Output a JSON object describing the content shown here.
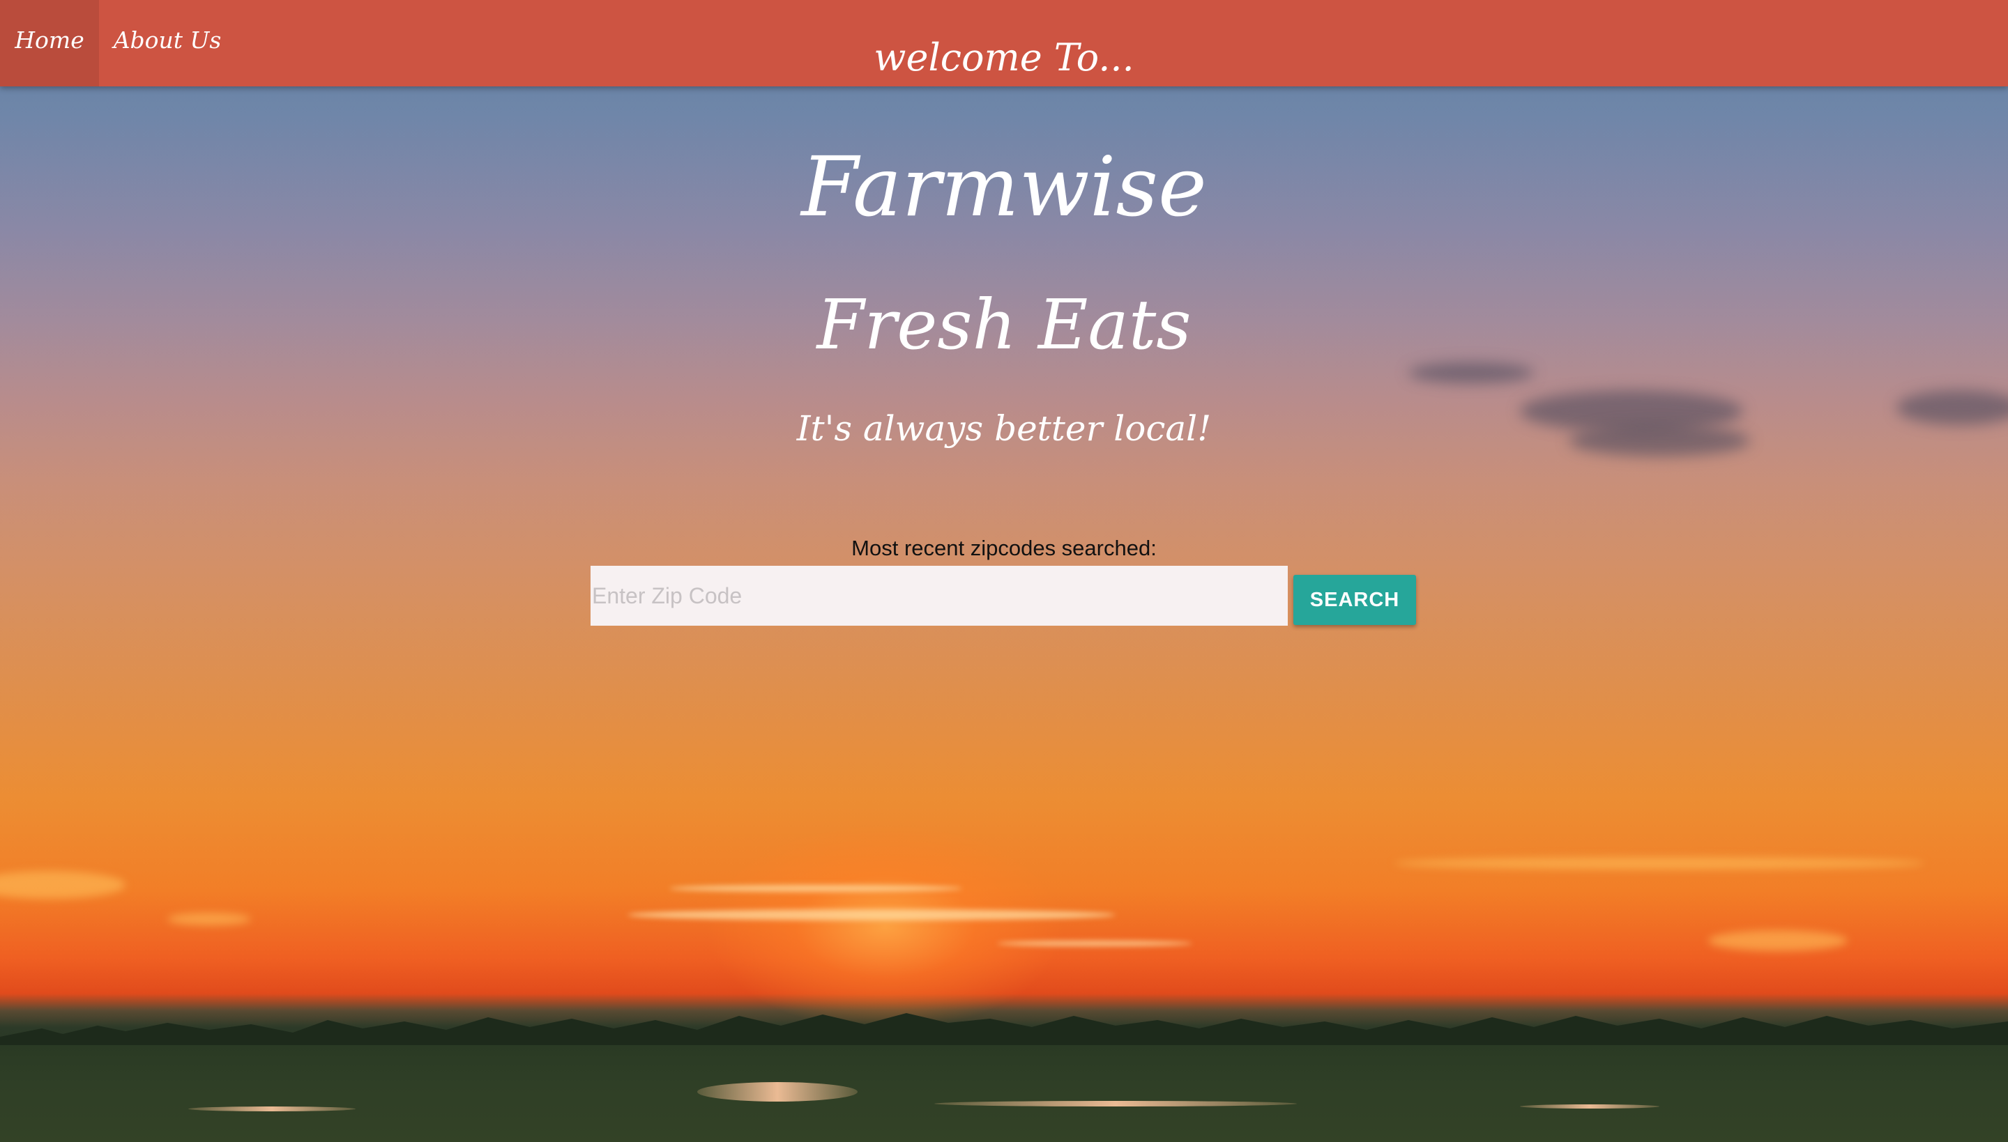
{
  "nav": {
    "items": [
      {
        "label": "Home"
      },
      {
        "label": "About Us"
      }
    ],
    "title": "welcome To...",
    "bar_color": "#cd5442"
  },
  "hero": {
    "title": "Farmwise",
    "subtitle": "Fresh Eats",
    "tagline": "It's always better local!"
  },
  "search": {
    "recent_label": "Most recent zipcodes searched:",
    "placeholder": "Enter Zip Code",
    "value": "",
    "button_label": "SEARCH",
    "button_color": "#26a69a"
  },
  "background": {
    "image": "sunset-over-farmland"
  }
}
